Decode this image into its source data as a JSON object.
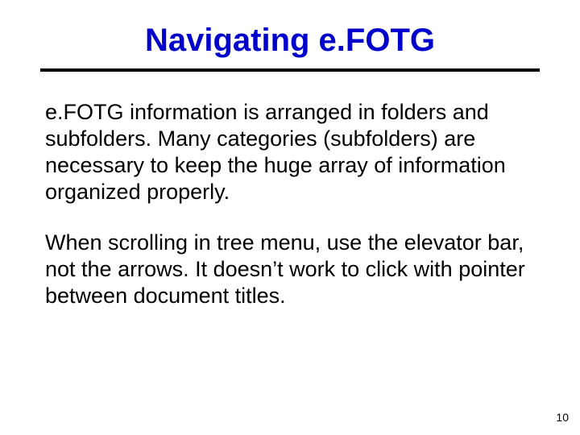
{
  "title": "Navigating e.FOTG",
  "paragraphs": [
    "e.FOTG information is arranged in folders and subfolders.  Many categories (subfolders) are necessary to keep the huge array of information organized properly.",
    "When scrolling in tree menu, use the elevator bar, not the arrows.  It doesn’t work to click with pointer between document titles."
  ],
  "page_number": "10"
}
